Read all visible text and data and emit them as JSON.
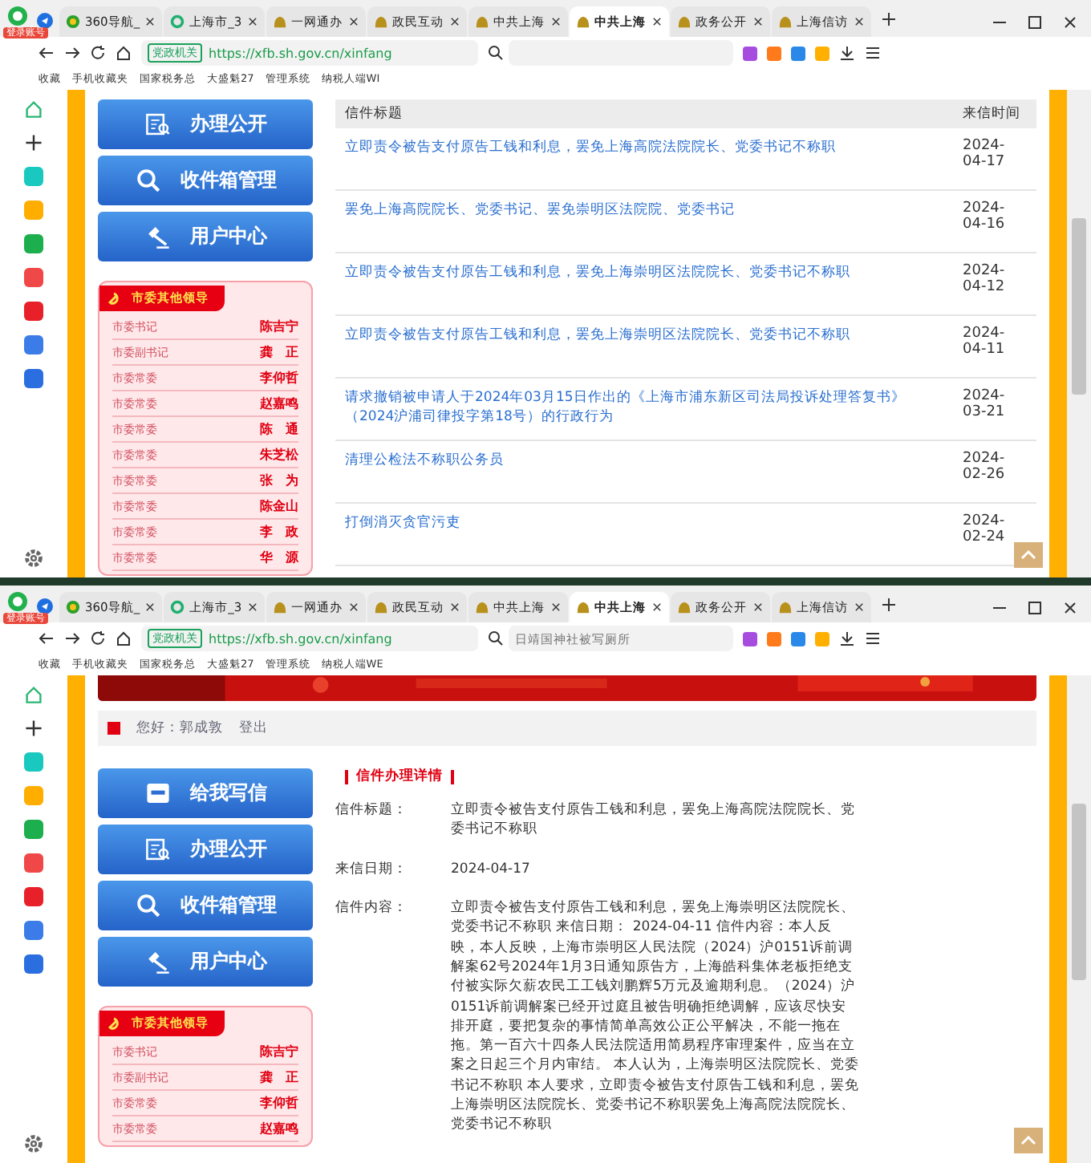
{
  "screens": [
    {
      "browser": {
        "badge": "登录账号",
        "tabs": [
          {
            "label": "360导航_",
            "selected": false,
            "kind": "nav"
          },
          {
            "label": "上海市_3",
            "selected": false,
            "kind": "ring"
          },
          {
            "label": "一网通办",
            "selected": false,
            "kind": "bell"
          },
          {
            "label": "政民互动",
            "selected": false,
            "kind": "bell"
          },
          {
            "label": "中共上海",
            "selected": false,
            "kind": "bell"
          },
          {
            "label": "中共上海",
            "selected": true,
            "kind": "bell"
          },
          {
            "label": "政务公开",
            "selected": false,
            "kind": "bell"
          },
          {
            "label": "上海信访",
            "selected": false,
            "kind": "bell"
          }
        ],
        "site_tag": "党政机关",
        "url": "https://xfb.sh.gov.cn/xinfang",
        "bookmarks": [
          "收藏",
          "手机收藏夹",
          "国家税务总",
          "大盛魁27",
          "管理系统",
          "纳税人端WI"
        ]
      },
      "page": {
        "kind": "list",
        "nav_buttons": [
          {
            "label": "办理公开",
            "kind": "open"
          },
          {
            "label": "收件箱管理",
            "kind": "inbox"
          },
          {
            "label": "用户中心",
            "kind": "user"
          }
        ],
        "leaders": {
          "title": "市委其他领导",
          "rows": [
            {
              "role": "市委书记",
              "name": "陈吉宁"
            },
            {
              "role": "市委副书记",
              "name": "龚　正"
            },
            {
              "role": "市委常委",
              "name": "李仰哲"
            },
            {
              "role": "市委常委",
              "name": "赵嘉鸣"
            },
            {
              "role": "市委常委",
              "name": "陈　通"
            },
            {
              "role": "市委常委",
              "name": "朱芝松"
            },
            {
              "role": "市委常委",
              "name": "张　为"
            },
            {
              "role": "市委常委",
              "name": "陈金山"
            },
            {
              "role": "市委常委",
              "name": "李　政"
            },
            {
              "role": "市委常委",
              "name": "华　源"
            }
          ]
        },
        "table": {
          "columns": [
            "信件标题",
            "来信时间"
          ],
          "rows": [
            {
              "title": "立即责令被告支付原告工钱和利息，罢免上海高院法院院长、党委书记不称职",
              "date": "2024-04-17"
            },
            {
              "title": "罢免上海高院院长、党委书记、罢免崇明区法院院、党委书记",
              "date": "2024-04-16"
            },
            {
              "title": "立即责令被告支付原告工钱和利息，罢免上海崇明区法院院长、党委书记不称职",
              "date": "2024-04-12"
            },
            {
              "title": "立即责令被告支付原告工钱和利息，罢免上海崇明区法院院长、党委书记不称职",
              "date": "2024-04-11"
            },
            {
              "title": "请求撤销被申请人于2024年03月15日作出的《上海市浦东新区司法局投诉处理答复书》（2024沪浦司律投字第18号）的行政行为",
              "date": "2024-03-21"
            },
            {
              "title": "清理公检法不称职公务员",
              "date": "2024-02-26"
            },
            {
              "title": "打倒消灭贪官污吏",
              "date": "2024-02-24"
            }
          ]
        }
      }
    },
    {
      "browser": {
        "badge": "登录账号",
        "tabs": [
          {
            "label": "360导航_",
            "selected": false,
            "kind": "nav"
          },
          {
            "label": "上海市_3",
            "selected": false,
            "kind": "ring"
          },
          {
            "label": "一网通办",
            "selected": false,
            "kind": "bell"
          },
          {
            "label": "政民互动",
            "selected": false,
            "kind": "bell"
          },
          {
            "label": "中共上海",
            "selected": false,
            "kind": "bell"
          },
          {
            "label": "中共上海",
            "selected": true,
            "kind": "bell"
          },
          {
            "label": "政务公开",
            "selected": false,
            "kind": "bell"
          },
          {
            "label": "上海信访",
            "selected": false,
            "kind": "bell"
          }
        ],
        "site_tag": "党政机关",
        "url": "https://xfb.sh.gov.cn/xinfang",
        "search_placeholder": "日靖国神社被写厕所",
        "bookmarks": [
          "收藏",
          "手机收藏夹",
          "国家税务总",
          "大盛魁27",
          "管理系统",
          "纳税人端WE"
        ]
      },
      "page": {
        "kind": "detail",
        "greeting": "您好：郭成敦",
        "logout": "登出",
        "nav_buttons": [
          {
            "label": "给我写信",
            "kind": "write"
          },
          {
            "label": "办理公开",
            "kind": "open"
          },
          {
            "label": "收件箱管理",
            "kind": "inbox"
          },
          {
            "label": "用户中心",
            "kind": "user"
          }
        ],
        "leaders": {
          "title": "市委其他领导",
          "rows": [
            {
              "role": "市委书记",
              "name": "陈吉宁"
            },
            {
              "role": "市委副书记",
              "name": "龚　正"
            },
            {
              "role": "市委常委",
              "name": "李仰哲"
            },
            {
              "role": "市委常委",
              "name": "赵嘉鸣"
            }
          ]
        },
        "detail": {
          "heading": "信件办理详情",
          "fields": [
            {
              "label": "信件标题：",
              "value": "立即责令被告支付原告工钱和利息，罢免上海高院法院院长、党委书记不称职"
            },
            {
              "label": "来信日期：",
              "value": "2024-04-17"
            },
            {
              "label": "信件内容：",
              "value": "立即责令被告支付原告工钱和利息，罢免上海崇明区法院院长、党委书记不称职 来信日期： 2024-04-11 信件内容：本人反映，本人反映，上海市崇明区人民法院（2024）沪0151诉前调解案62号2024年1月3日通知原告方，上海皓科集体老板拒绝支付被实际欠薪农民工工钱刘鹏辉5万元及逾期利息。（2024）沪0151诉前调解案已经开过庭且被告明确拒绝调解，应该尽快安排开庭，要把复杂的事情简单高效公正公平解决，不能一拖在拖。第一百六十四条人民法院适用简易程序审理案件，应当在立案之日起三个月内审结。 本人认为，上海崇明区法院院长、党委书记不称职 本人要求，立即责令被告支付原告工钱和利息，罢免上海崇明区法院院长、党委书记不称职罢免上海高院法院院长、党委书记不称职"
            }
          ]
        }
      }
    }
  ]
}
